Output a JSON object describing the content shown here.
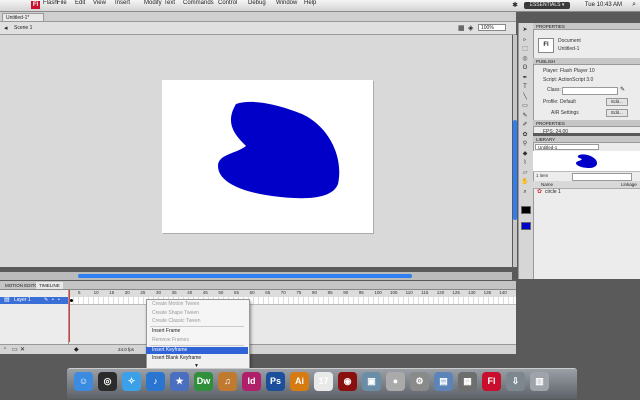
{
  "menubar": {
    "items": [
      "Flash",
      "File",
      "Edit",
      "View",
      "Insert",
      "Modify",
      "Text",
      "Commands",
      "Control",
      "Debug",
      "Window",
      "Help"
    ],
    "workspace": "ESSENTIALS ▾",
    "clock": "Tue 10:43 AM"
  },
  "document": {
    "tab": "Untitled-1*",
    "scene": "Scene 1",
    "zoom": "100%"
  },
  "timeline": {
    "tabs": [
      "MOTION EDITOR",
      "TIMELINE"
    ],
    "layer": "Layer 1",
    "ruler": [
      "5",
      "10",
      "15",
      "20",
      "25",
      "30",
      "35",
      "40",
      "45",
      "50",
      "55",
      "60",
      "65",
      "70",
      "75",
      "80",
      "85",
      "90",
      "95",
      "100",
      "105",
      "110",
      "115",
      "120",
      "125",
      "130",
      "135",
      "140"
    ],
    "fps": "24.0 fps"
  },
  "context_menu": {
    "items": [
      {
        "label": "Create Motion Tween",
        "state": "disabled"
      },
      {
        "label": "Create Shape Tween",
        "state": "disabled"
      },
      {
        "label": "Create Classic Tween",
        "state": "disabled"
      },
      {
        "label": "Insert Frame",
        "state": "enabled"
      },
      {
        "label": "Remove Frames",
        "state": "disabled"
      },
      {
        "label": "Insert Keyframe",
        "state": "highlighted"
      },
      {
        "label": "Insert Blank Keyframe",
        "state": "enabled"
      }
    ],
    "more": "▼"
  },
  "properties": {
    "header": "PROPERTIES",
    "doc_icon": "Fl",
    "doc_type": "Document",
    "doc_name": "Untitled-1",
    "publish_header": "PUBLISH",
    "player": "Player:  Flash Player 10",
    "script": "Script:  ActionScript 3.0",
    "class_label": "Class:",
    "profile": "Profile:  Default",
    "edit_btn": "Edit...",
    "air": "AIR Settings",
    "edit_btn2": "Edit...",
    "props_header": "PROPERTIES",
    "fps": "FPS: 24.00"
  },
  "library": {
    "header": "LIBRARY",
    "doc": "Untitled-1",
    "count": "1 item",
    "col_name": "Name",
    "col_linkage": "Linkage",
    "item": "circle 1"
  },
  "colors": {
    "shape_fill": "#0000c8",
    "highlight": "#2f63d6",
    "layer_selected": "#3a6fd8"
  },
  "dock": {
    "apps": [
      {
        "icon": "finder-icon",
        "color": "#3b8be0",
        "glyph": "☺"
      },
      {
        "icon": "dashboard-icon",
        "color": "#2b2b2b",
        "glyph": "◎"
      },
      {
        "icon": "safari-icon",
        "color": "#3aa0e8",
        "glyph": "✧"
      },
      {
        "icon": "itunes-icon",
        "color": "#2a75d0",
        "glyph": "♪"
      },
      {
        "icon": "imovie-icon",
        "color": "#4a6ec0",
        "glyph": "★"
      },
      {
        "icon": "dreamweaver-icon",
        "color": "#2f8f3a",
        "glyph": "Dw"
      },
      {
        "icon": "garageband-icon",
        "color": "#c07a30",
        "glyph": "♫"
      },
      {
        "icon": "indesign-icon",
        "color": "#b0206a",
        "glyph": "Id"
      },
      {
        "icon": "photoshop-icon",
        "color": "#1b4f9c",
        "glyph": "Ps"
      },
      {
        "icon": "illustrator-icon",
        "color": "#d57b12",
        "glyph": "Ai"
      },
      {
        "icon": "ical-icon",
        "color": "#e9e9e9",
        "glyph": "17"
      },
      {
        "icon": "photo-booth-icon",
        "color": "#8a1010",
        "glyph": "◉"
      },
      {
        "icon": "iphoto-icon",
        "color": "#6a8ea8",
        "glyph": "▣"
      },
      {
        "icon": "apple-icon",
        "color": "#aaaaaa",
        "glyph": "●"
      },
      {
        "icon": "preferences-icon",
        "color": "#8a8a8a",
        "glyph": "⚙"
      },
      {
        "icon": "preview-icon",
        "color": "#5d84b8",
        "glyph": "▤"
      },
      {
        "icon": "expose-icon",
        "color": "#6e6e6e",
        "glyph": "▦"
      },
      {
        "icon": "flash-icon",
        "color": "#c8102e",
        "glyph": "Fl"
      },
      {
        "icon": "downloads-icon",
        "color": "#7c8790",
        "glyph": "⇩"
      },
      {
        "icon": "trash-icon",
        "color": "#9ea4aa",
        "glyph": "▥"
      }
    ]
  }
}
